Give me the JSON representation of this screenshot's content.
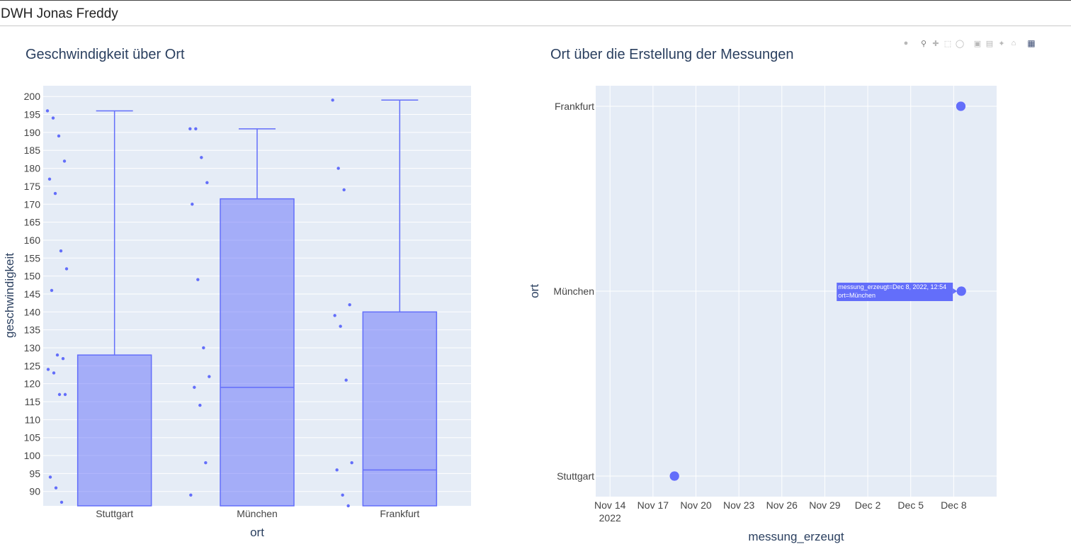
{
  "header": {
    "title": "DWH Jonas Freddy"
  },
  "modebar": {
    "icons": [
      "camera-icon",
      "zoom-icon",
      "pan-icon",
      "box-select-icon",
      "lasso-icon",
      "zoom-in-icon",
      "zoom-out-icon",
      "autoscale-icon",
      "reset-axes-icon",
      "plotly-logo-icon"
    ]
  },
  "colors": {
    "accent": "#636efa",
    "plot_bg": "#e5ecf6",
    "grid": "#ffffff",
    "text": "#2a3f5f"
  },
  "chart_data": [
    {
      "type": "box",
      "title": "Geschwindigkeit über Ort",
      "xlabel": "ort",
      "ylabel": "geschwindigkeit",
      "categories": [
        "Stuttgart",
        "München",
        "Frankfurt"
      ],
      "ylim": [
        86,
        203
      ],
      "yticks": [
        90,
        95,
        100,
        105,
        110,
        115,
        120,
        125,
        130,
        135,
        140,
        145,
        150,
        155,
        160,
        165,
        170,
        175,
        180,
        185,
        190,
        195,
        200
      ],
      "grid": true,
      "boxes": [
        {
          "category": "Stuttgart",
          "q1": 80,
          "median": 80,
          "q3": 128,
          "lower_fence": 80,
          "upper_fence": 196,
          "points": [
            196,
            194,
            189,
            182,
            177,
            173,
            157,
            152,
            146,
            128,
            127,
            124,
            123,
            117,
            117,
            94,
            91,
            87
          ]
        },
        {
          "category": "München",
          "q1": 80,
          "median": 119,
          "q3": 171.5,
          "lower_fence": 80,
          "upper_fence": 191,
          "points": [
            191,
            191,
            183,
            176,
            170,
            149,
            130,
            122,
            119,
            114,
            98,
            89
          ]
        },
        {
          "category": "Frankfurt",
          "q1": 80,
          "median": 96,
          "q3": 140,
          "lower_fence": 80,
          "upper_fence": 199,
          "points": [
            199,
            180,
            174,
            142,
            139,
            136,
            121,
            98,
            96,
            89,
            86
          ]
        }
      ]
    },
    {
      "type": "scatter",
      "title": "Ort über die Erstellung der Messungen",
      "xlabel": "messung_erzeugt",
      "ylabel": "ort",
      "categories": [
        "Stuttgart",
        "München",
        "Frankfurt"
      ],
      "x_tick_labels": [
        "Nov 14",
        "Nov 17",
        "Nov 20",
        "Nov 23",
        "Nov 26",
        "Nov 29",
        "Dec 2",
        "Dec 5",
        "Dec 8"
      ],
      "x_tick_dates": [
        "2022-11-14",
        "2022-11-17",
        "2022-11-20",
        "2022-11-23",
        "2022-11-26",
        "2022-11-29",
        "2022-12-02",
        "2022-12-05",
        "2022-12-08"
      ],
      "x_year_label": "2022",
      "xlim": [
        "2022-11-13",
        "2022-12-11"
      ],
      "grid": true,
      "points": [
        {
          "x": "2022-11-18T12:00",
          "y": "Stuttgart"
        },
        {
          "x": "2022-12-08T12:54",
          "y": "München"
        },
        {
          "x": "2022-12-08T12:00",
          "y": "Frankfurt"
        }
      ],
      "hover": {
        "line1": "messung_erzeugt=Dec 8, 2022, 12:54",
        "line2": "ort=München"
      }
    }
  ]
}
